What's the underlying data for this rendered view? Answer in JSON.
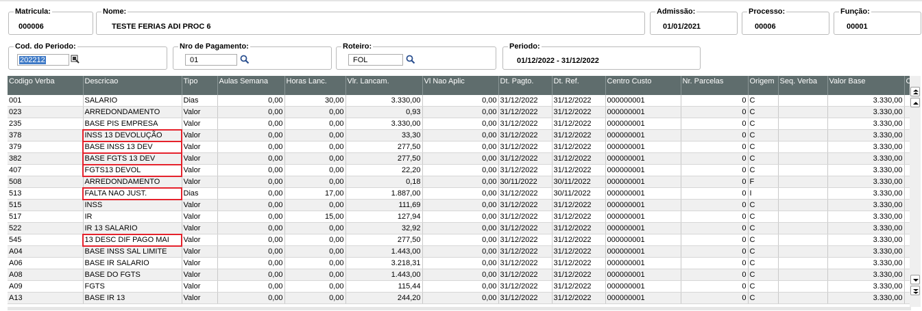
{
  "header": {
    "matricula": {
      "label": "Matricula:",
      "value": "000006"
    },
    "nome": {
      "label": "Nome:",
      "value": "TESTE FERIAS ADI PROC 6"
    },
    "admissao": {
      "label": "Admissão:",
      "value": "01/01/2021"
    },
    "processo": {
      "label": "Processo:",
      "value": "00006"
    },
    "funcao": {
      "label": "Função:",
      "value": "00001"
    },
    "cod_periodo": {
      "label": "Cod. do Periodo:",
      "value": "202212"
    },
    "nro_pagamento": {
      "label": "Nro de Pagamento:",
      "value": "01"
    },
    "roteiro": {
      "label": "Roteiro:",
      "value": "FOL"
    },
    "periodo": {
      "label": "Periodo:",
      "value": "01/12/2022 - 31/12/2022"
    }
  },
  "grid": {
    "columns": [
      "Codigo Verba",
      "Descricao",
      "Tipo",
      "Aulas Semana",
      "Horas Lanc.",
      "Vlr. Lancam.",
      "Vl Nao Aplic",
      "Dt. Pagto.",
      "Dt. Ref.",
      "Centro Custo",
      "Nr. Parcelas",
      "Origem",
      "Seq. Verba",
      "Valor Base",
      "C"
    ],
    "rows": [
      {
        "cod": "001",
        "desc": "SALARIO",
        "tipo": "Dias",
        "aulas": "0,00",
        "horas": "30,00",
        "vlr": "3.330,00",
        "vlna": "0,00",
        "dtp": "31/12/2022",
        "dtr": "31/12/2022",
        "cc": "000000001",
        "parc": "0",
        "orig": "C",
        "seq": "",
        "base": "3.330,00",
        "hl": false
      },
      {
        "cod": "023",
        "desc": "ARREDONDAMENTO",
        "tipo": "Valor",
        "aulas": "0,00",
        "horas": "0,00",
        "vlr": "0,93",
        "vlna": "0,00",
        "dtp": "31/12/2022",
        "dtr": "31/12/2022",
        "cc": "000000001",
        "parc": "0",
        "orig": "C",
        "seq": "",
        "base": "3.330,00",
        "hl": false
      },
      {
        "cod": "235",
        "desc": "BASE PIS EMPRESA",
        "tipo": "Valor",
        "aulas": "0,00",
        "horas": "0,00",
        "vlr": "3.330,00",
        "vlna": "0,00",
        "dtp": "31/12/2022",
        "dtr": "31/12/2022",
        "cc": "000000001",
        "parc": "0",
        "orig": "C",
        "seq": "",
        "base": "3.330,00",
        "hl": false
      },
      {
        "cod": "378",
        "desc": "INSS 13 DEVOLUÇÃO",
        "tipo": "Valor",
        "aulas": "0,00",
        "horas": "0,00",
        "vlr": "33,30",
        "vlna": "0,00",
        "dtp": "31/12/2022",
        "dtr": "31/12/2022",
        "cc": "000000001",
        "parc": "0",
        "orig": "C",
        "seq": "",
        "base": "3.330,00",
        "hl": true
      },
      {
        "cod": "379",
        "desc": "BASE INSS 13 DEV",
        "tipo": "Valor",
        "aulas": "0,00",
        "horas": "0,00",
        "vlr": "277,50",
        "vlna": "0,00",
        "dtp": "31/12/2022",
        "dtr": "31/12/2022",
        "cc": "000000001",
        "parc": "0",
        "orig": "C",
        "seq": "",
        "base": "3.330,00",
        "hl": true
      },
      {
        "cod": "382",
        "desc": "BASE FGTS 13 DEV",
        "tipo": "Valor",
        "aulas": "0,00",
        "horas": "0,00",
        "vlr": "277,50",
        "vlna": "0,00",
        "dtp": "31/12/2022",
        "dtr": "31/12/2022",
        "cc": "000000001",
        "parc": "0",
        "orig": "C",
        "seq": "",
        "base": "3.330,00",
        "hl": true
      },
      {
        "cod": "407",
        "desc": "FGTS13 DEVOL",
        "tipo": "Valor",
        "aulas": "0,00",
        "horas": "0,00",
        "vlr": "22,20",
        "vlna": "0,00",
        "dtp": "31/12/2022",
        "dtr": "31/12/2022",
        "cc": "000000001",
        "parc": "0",
        "orig": "C",
        "seq": "",
        "base": "3.330,00",
        "hl": true
      },
      {
        "cod": "508",
        "desc": "ARREDONDAMENTO",
        "tipo": "Valor",
        "aulas": "0,00",
        "horas": "0,00",
        "vlr": "0,18",
        "vlna": "0,00",
        "dtp": "30/11/2022",
        "dtr": "30/11/2022",
        "cc": "000000001",
        "parc": "0",
        "orig": "F",
        "seq": "",
        "base": "3.330,00",
        "hl": false
      },
      {
        "cod": "513",
        "desc": "FALTA NAO JUST.",
        "tipo": "Dias",
        "aulas": "0,00",
        "horas": "17,00",
        "vlr": "1.887,00",
        "vlna": "0,00",
        "dtp": "31/12/2022",
        "dtr": "30/11/2022",
        "cc": "000000001",
        "parc": "0",
        "orig": "I",
        "seq": "",
        "base": "3.330,00",
        "hl": true
      },
      {
        "cod": "515",
        "desc": "INSS",
        "tipo": "Valor",
        "aulas": "0,00",
        "horas": "0,00",
        "vlr": "111,69",
        "vlna": "0,00",
        "dtp": "31/12/2022",
        "dtr": "31/12/2022",
        "cc": "000000001",
        "parc": "0",
        "orig": "C",
        "seq": "",
        "base": "3.330,00",
        "hl": false
      },
      {
        "cod": "517",
        "desc": "IR",
        "tipo": "Valor",
        "aulas": "0,00",
        "horas": "15,00",
        "vlr": "127,94",
        "vlna": "0,00",
        "dtp": "31/12/2022",
        "dtr": "31/12/2022",
        "cc": "000000001",
        "parc": "0",
        "orig": "C",
        "seq": "",
        "base": "3.330,00",
        "hl": false
      },
      {
        "cod": "522",
        "desc": "IR 13 SALARIO",
        "tipo": "Valor",
        "aulas": "0,00",
        "horas": "0,00",
        "vlr": "32,92",
        "vlna": "0,00",
        "dtp": "31/12/2022",
        "dtr": "31/12/2022",
        "cc": "000000001",
        "parc": "0",
        "orig": "C",
        "seq": "",
        "base": "3.330,00",
        "hl": false
      },
      {
        "cod": "545",
        "desc": "13 DESC DIF PAGO MAI",
        "tipo": "Valor",
        "aulas": "0,00",
        "horas": "0,00",
        "vlr": "277,50",
        "vlna": "0,00",
        "dtp": "31/12/2022",
        "dtr": "31/12/2022",
        "cc": "000000001",
        "parc": "0",
        "orig": "C",
        "seq": "",
        "base": "3.330,00",
        "hl": true
      },
      {
        "cod": "A04",
        "desc": "BASE INSS SAL LIMITE",
        "tipo": "Valor",
        "aulas": "0,00",
        "horas": "0,00",
        "vlr": "1.443,00",
        "vlna": "0,00",
        "dtp": "31/12/2022",
        "dtr": "31/12/2022",
        "cc": "000000001",
        "parc": "0",
        "orig": "C",
        "seq": "",
        "base": "3.330,00",
        "hl": false
      },
      {
        "cod": "A06",
        "desc": "BASE IR SALARIO",
        "tipo": "Valor",
        "aulas": "0,00",
        "horas": "0,00",
        "vlr": "3.218,31",
        "vlna": "0,00",
        "dtp": "31/12/2022",
        "dtr": "31/12/2022",
        "cc": "000000001",
        "parc": "0",
        "orig": "C",
        "seq": "",
        "base": "3.330,00",
        "hl": false
      },
      {
        "cod": "A08",
        "desc": "BASE DO FGTS",
        "tipo": "Valor",
        "aulas": "0,00",
        "horas": "0,00",
        "vlr": "1.443,00",
        "vlna": "0,00",
        "dtp": "31/12/2022",
        "dtr": "31/12/2022",
        "cc": "000000001",
        "parc": "0",
        "orig": "C",
        "seq": "",
        "base": "3.330,00",
        "hl": false
      },
      {
        "cod": "A09",
        "desc": "FGTS",
        "tipo": "Valor",
        "aulas": "0,00",
        "horas": "0,00",
        "vlr": "115,44",
        "vlna": "0,00",
        "dtp": "31/12/2022",
        "dtr": "31/12/2022",
        "cc": "000000001",
        "parc": "0",
        "orig": "C",
        "seq": "",
        "base": "3.330,00",
        "hl": false
      },
      {
        "cod": "A13",
        "desc": "BASE IR 13",
        "tipo": "Valor",
        "aulas": "0,00",
        "horas": "0,00",
        "vlr": "244,20",
        "vlna": "0,00",
        "dtp": "31/12/2022",
        "dtr": "31/12/2022",
        "cc": "000000001",
        "parc": "0",
        "orig": "C",
        "seq": "",
        "base": "3.330,00",
        "hl": false
      }
    ]
  },
  "colors": {
    "header_bg": "#5f6d6d",
    "highlight": "#e5212b",
    "selection": "#3d79c6"
  },
  "icons": {
    "search": "search-icon",
    "calendar": "lookup-icon",
    "scroll_top": "scroll-top-icon",
    "scroll_up": "scroll-up-icon",
    "scroll_down": "scroll-down-icon",
    "scroll_bottom": "scroll-bottom-icon"
  }
}
